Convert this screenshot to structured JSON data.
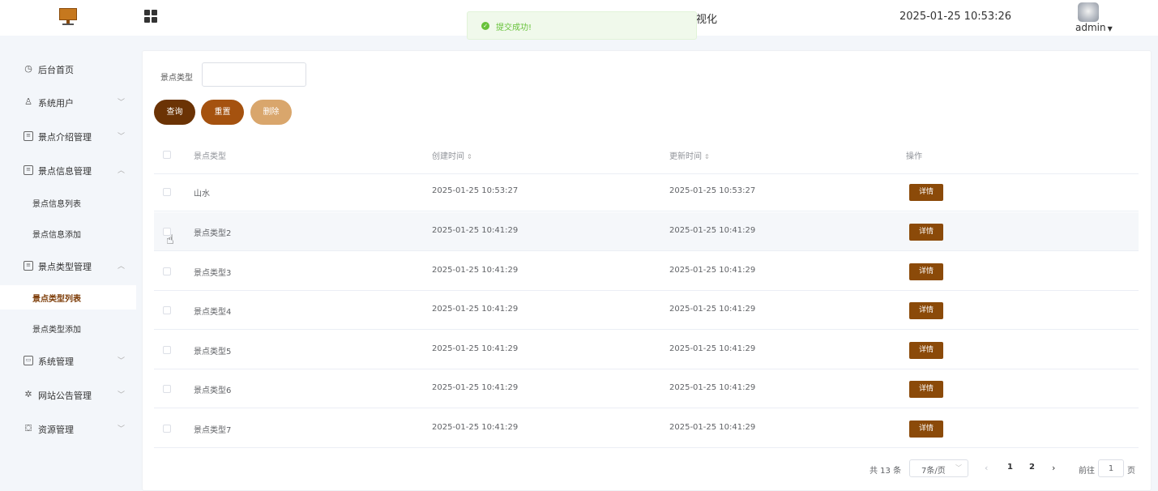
{
  "header": {
    "title": "视化",
    "datetime": "2025-01-25 10:53:26",
    "user": "admin",
    "logo_icon": "monitor-logo-icon",
    "menu_icon": "grid-icon"
  },
  "toast": {
    "message": "提交成功!",
    "type": "success",
    "icon": "check-circle-icon"
  },
  "sidebar": {
    "items": [
      {
        "label": "后台首页",
        "icon": "clock-icon"
      },
      {
        "label": "系统用户",
        "icon": "user-icon"
      },
      {
        "label": "景点介绍管理",
        "icon": "card-icon"
      },
      {
        "label": "景点信息管理",
        "icon": "card-icon"
      },
      {
        "label": "景点信息列表"
      },
      {
        "label": "景点信息添加"
      },
      {
        "label": "景点类型管理",
        "icon": "card-icon"
      },
      {
        "label": "景点类型列表"
      },
      {
        "label": "景点类型添加"
      },
      {
        "label": "系统管理",
        "icon": "folder-icon"
      },
      {
        "label": "网站公告管理",
        "icon": "sparkle-icon"
      },
      {
        "label": "资源管理",
        "icon": "box-icon"
      }
    ]
  },
  "search": {
    "label": "景点类型",
    "value": ""
  },
  "buttons": {
    "query": "查询",
    "reset": "重置",
    "delete": "删除"
  },
  "table": {
    "headers": [
      "景点类型",
      "创建时间",
      "更新时间",
      "操作"
    ],
    "action_label": "详情",
    "rows": [
      {
        "type": "山水",
        "created": "2025-01-25 10:53:27",
        "updated": "2025-01-25 10:53:27"
      },
      {
        "type": "景点类型2",
        "created": "2025-01-25 10:41:29",
        "updated": "2025-01-25 10:41:29"
      },
      {
        "type": "景点类型3",
        "created": "2025-01-25 10:41:29",
        "updated": "2025-01-25 10:41:29"
      },
      {
        "type": "景点类型4",
        "created": "2025-01-25 10:41:29",
        "updated": "2025-01-25 10:41:29"
      },
      {
        "type": "景点类型5",
        "created": "2025-01-25 10:41:29",
        "updated": "2025-01-25 10:41:29"
      },
      {
        "type": "景点类型6",
        "created": "2025-01-25 10:41:29",
        "updated": "2025-01-25 10:41:29"
      },
      {
        "type": "景点类型7",
        "created": "2025-01-25 10:41:29",
        "updated": "2025-01-25 10:41:29"
      }
    ]
  },
  "pagination": {
    "total": "共 13 条",
    "page_size": "7条/页",
    "pages": [
      "1",
      "2"
    ],
    "goto_label": "前往",
    "goto_value": "1",
    "page_suffix": "页"
  },
  "colors": {
    "accent_dark": "#6b3305",
    "accent": "#a5520f",
    "accent_light": "#d9a66c",
    "detail_button": "#8b4a09",
    "success": "#67c23a"
  }
}
